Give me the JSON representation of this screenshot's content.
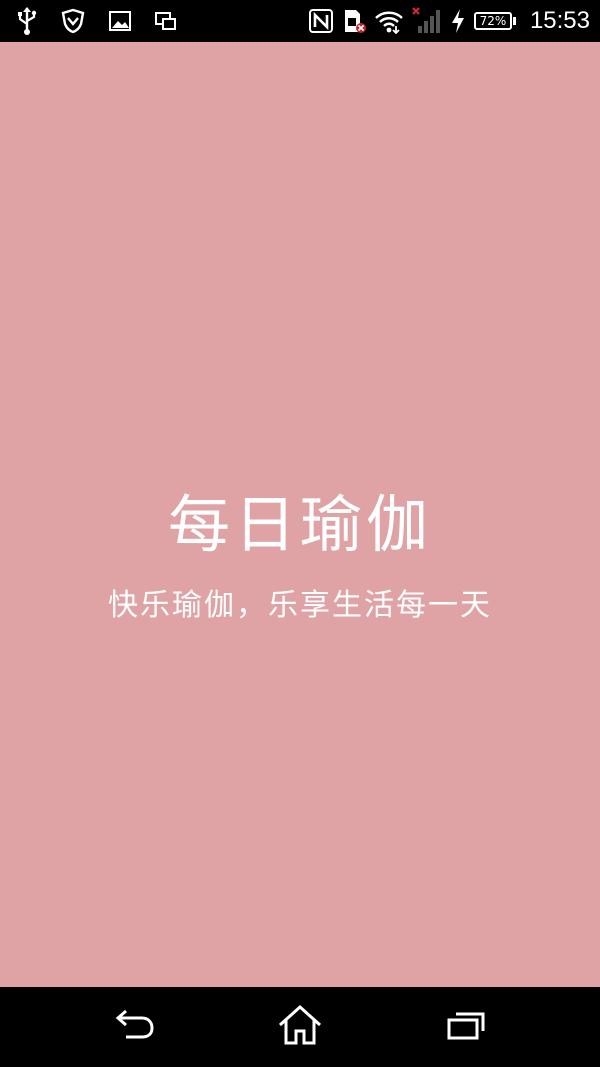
{
  "status_bar": {
    "left_icons": [
      "usb-icon",
      "shield-icon",
      "image-icon",
      "screen-mirror-icon"
    ],
    "right_icons": [
      "nfc-icon",
      "sim-error-icon",
      "wifi-icon",
      "signal-icon",
      "charging-icon"
    ],
    "battery_percent": "72%",
    "battery_level": 0.72,
    "time": "15:53"
  },
  "splash": {
    "background_color": "#e0a3a5",
    "title": "每日瑜伽",
    "slogan": "快乐瑜伽，乐享生活每一天"
  },
  "nav_bar": {
    "buttons": [
      "back-icon",
      "home-icon",
      "recent-apps-icon"
    ]
  }
}
